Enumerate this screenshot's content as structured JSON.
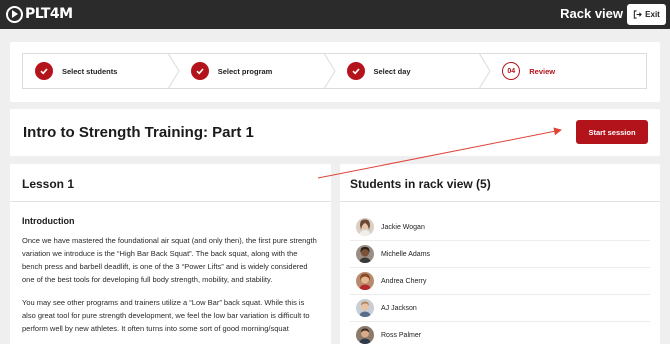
{
  "app": {
    "logo_text": "PLT4M",
    "page_title": "Rack view",
    "exit_label": "Exit"
  },
  "colors": {
    "brand_red": "#b3131b",
    "topbar": "#2b2b2b",
    "annotation_arrow": "#e0433a"
  },
  "steps": [
    {
      "label": "Select students",
      "state": "done"
    },
    {
      "label": "Select program",
      "state": "done"
    },
    {
      "label": "Select day",
      "state": "done"
    },
    {
      "number": "04",
      "label": "Review",
      "state": "active"
    }
  ],
  "course": {
    "title": "Intro to Strength Training: Part 1",
    "start_label": "Start session"
  },
  "lesson": {
    "title": "Lesson 1",
    "section": "Introduction",
    "paragraphs": [
      "Once we have mastered the foundational air squat (and only then), the first pure strength variation we introduce is the “High Bar Back Squat”. The back squat, along with the bench press and barbell deadlift, is one of the 3 “Power Lifts” and is widely considered one of the best tools for developing full body strength, mobility, and stability.",
      "You may see other programs and trainers utilize a “Low Bar” back squat. While this is also great tool for pure strength development, we feel the low bar variation is difficult to perform well by new athletes. It often turns into some sort of good morning/squat"
    ]
  },
  "students": {
    "title": "Students in rack view (5)",
    "list": [
      {
        "name": "Jackie Wogan"
      },
      {
        "name": "Michelle Adams"
      },
      {
        "name": "Andrea Cherry"
      },
      {
        "name": "AJ Jackson"
      },
      {
        "name": "Ross Palmer"
      }
    ]
  }
}
